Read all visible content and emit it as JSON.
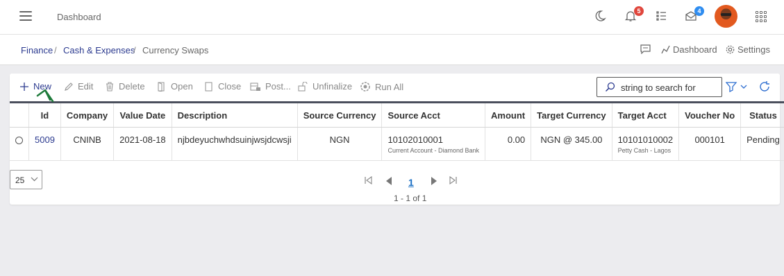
{
  "header": {
    "title": "Dashboard",
    "notifications_count": "5",
    "messages_count": "4",
    "colors": {
      "notif_badge": "#e0463c",
      "msg_badge": "#2f8df0"
    }
  },
  "breadcrumb": {
    "items": [
      "Finance",
      "Cash & Expenses",
      "Currency Swaps"
    ],
    "separator": "/",
    "dashboard_link": "Dashboard",
    "settings_link": "Settings"
  },
  "toolbar": {
    "new": "New",
    "edit": "Edit",
    "delete": "Delete",
    "open": "Open",
    "close": "Close",
    "post": "Post...",
    "unfinalize": "Unfinalize",
    "run_all": "Run All",
    "search_placeholder": "string to search for"
  },
  "table": {
    "columns": [
      "Id",
      "Company",
      "Value Date",
      "Description",
      "Source Currency",
      "Source Acct",
      "Amount",
      "Target Currency",
      "Target Acct",
      "Voucher No",
      "Status"
    ],
    "rows": [
      {
        "id": "5009",
        "company": "CNINB",
        "value_date": "2021-08-18",
        "description": "njbdeyuchwhdsuinjwsjdcwsji",
        "source_currency": "NGN",
        "source_acct": "10102010001",
        "source_acct_name": "Current Account - Diamond Bank",
        "amount": "0.00",
        "target_currency": "NGN @ 345.00",
        "target_acct": "10101010002",
        "target_acct_name": "Petty Cash - Lagos",
        "voucher_no": "000101",
        "status": "Pending"
      }
    ]
  },
  "pagination": {
    "page_size": "25",
    "current_page": "1",
    "summary": "1 - 1 of 1"
  }
}
